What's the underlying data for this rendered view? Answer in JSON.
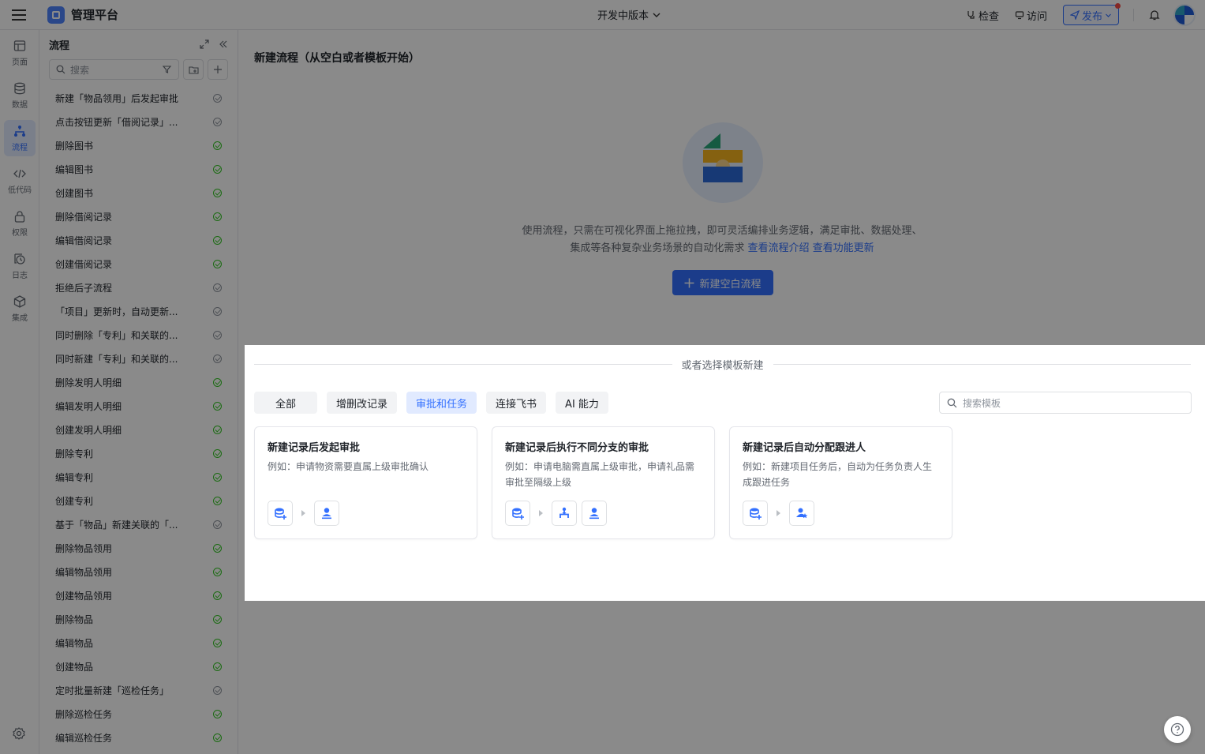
{
  "topbar": {
    "app_title": "管理平台",
    "version_label": "开发中版本",
    "check_label": "检查",
    "visit_label": "访问",
    "publish_label": "发布"
  },
  "rail": {
    "items": [
      {
        "label": "页面",
        "icon": "page-icon"
      },
      {
        "label": "数据",
        "icon": "database-icon"
      },
      {
        "label": "流程",
        "icon": "flow-icon"
      },
      {
        "label": "低代码",
        "icon": "code-icon"
      },
      {
        "label": "权限",
        "icon": "lock-icon"
      },
      {
        "label": "日志",
        "icon": "log-icon"
      },
      {
        "label": "集成",
        "icon": "cube-icon"
      }
    ]
  },
  "sidebar": {
    "title": "流程",
    "search_placeholder": "搜索",
    "flows": [
      {
        "name": "新建「物品领用」后发起审批",
        "status": "gray"
      },
      {
        "name": "点击按钮更新「借阅记录」...",
        "status": "gray"
      },
      {
        "name": "删除图书",
        "status": "green"
      },
      {
        "name": "编辑图书",
        "status": "green"
      },
      {
        "name": "创建图书",
        "status": "green"
      },
      {
        "name": "删除借阅记录",
        "status": "green"
      },
      {
        "name": "编辑借阅记录",
        "status": "green"
      },
      {
        "name": "创建借阅记录",
        "status": "green"
      },
      {
        "name": "拒绝后子流程",
        "status": "gray"
      },
      {
        "name": "「项目」更新时，自动更新...",
        "status": "gray"
      },
      {
        "name": "同时删除「专利」和关联的...",
        "status": "gray"
      },
      {
        "name": "同时新建「专利」和关联的...",
        "status": "gray"
      },
      {
        "name": "删除发明人明细",
        "status": "green"
      },
      {
        "name": "编辑发明人明细",
        "status": "green"
      },
      {
        "name": "创建发明人明细",
        "status": "green"
      },
      {
        "name": "删除专利",
        "status": "green"
      },
      {
        "name": "编辑专利",
        "status": "green"
      },
      {
        "name": "创建专利",
        "status": "green"
      },
      {
        "name": "基于「物品」新建关联的「...",
        "status": "gray"
      },
      {
        "name": "删除物品领用",
        "status": "green"
      },
      {
        "name": "编辑物品领用",
        "status": "green"
      },
      {
        "name": "创建物品领用",
        "status": "green"
      },
      {
        "name": "删除物品",
        "status": "green"
      },
      {
        "name": "编辑物品",
        "status": "green"
      },
      {
        "name": "创建物品",
        "status": "green"
      },
      {
        "name": "定时批量新建「巡检任务」",
        "status": "gray"
      },
      {
        "name": "删除巡检任务",
        "status": "green"
      },
      {
        "name": "编辑巡检任务",
        "status": "green"
      }
    ]
  },
  "main": {
    "title": "新建流程（从空白或者模板开始）",
    "description": "使用流程，只需在可视化界面上拖拉拽，即可灵活编排业务逻辑，满足审批、数据处理、集成等各种复杂业务场景的自动化需求",
    "link_intro": "查看流程介绍",
    "link_updates": "查看功能更新",
    "new_blank_label": "新建空白流程"
  },
  "templates": {
    "divider_text": "或者选择模板新建",
    "tabs": [
      {
        "label": "全部",
        "active": false
      },
      {
        "label": "增删改记录",
        "active": false
      },
      {
        "label": "审批和任务",
        "active": true
      },
      {
        "label": "连接飞书",
        "active": false
      },
      {
        "label": "AI 能力",
        "active": false
      }
    ],
    "search_placeholder": "搜索模板",
    "cards": [
      {
        "title": "新建记录后发起审批",
        "desc": "例如：申请物资需要直属上级审批确认",
        "icons": [
          "database-add-icon",
          "approver-icon"
        ]
      },
      {
        "title": "新建记录后执行不同分支的审批",
        "desc": "例如：申请电脑需直属上级审批，申请礼品需审批至隔级上级",
        "icons": [
          "database-add-icon",
          "branch-icon",
          "approver-icon"
        ]
      },
      {
        "title": "新建记录后自动分配跟进人",
        "desc": "例如：新建项目任务后，自动为任务负责人生成跟进任务",
        "icons": [
          "database-add-icon",
          "assignee-icon"
        ]
      }
    ]
  },
  "colors": {
    "accent": "#3370ff",
    "success": "#34c724",
    "overlay": "rgba(0,0,0,0.46)"
  }
}
